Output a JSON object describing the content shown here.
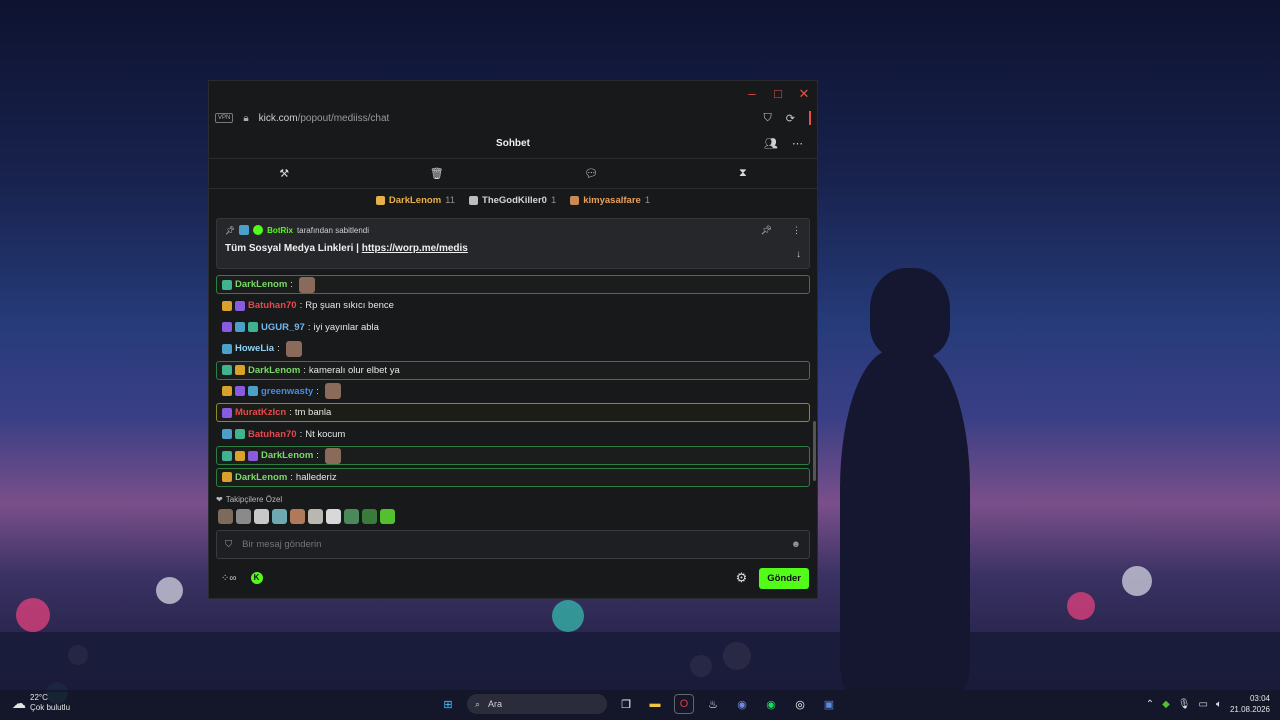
{
  "window": {
    "url_host": "kick.com",
    "url_path": "/popout/mediiss/chat",
    "vpn_label": "VPN"
  },
  "chat": {
    "title": "Sohbet",
    "leaders": [
      {
        "name": "DarkLenom",
        "count": "11",
        "color": "#e9b04a"
      },
      {
        "name": "TheGodKiller0",
        "count": "1",
        "color": "#d5d5d5"
      },
      {
        "name": "kimyasalfare",
        "count": "1",
        "color": "#e9a05a"
      }
    ],
    "pinned": {
      "by_user": "BotRix",
      "by_suffix": "tarafından sabitlendi",
      "text": "Tüm Sosyal Medya Linkleri | ",
      "link": "https://worp.me/medis"
    },
    "messages": [
      {
        "user": "DarkLenom",
        "text": "",
        "color": "#7bd96a",
        "highlight": "green",
        "emote": true
      },
      {
        "user": "Batuhan70",
        "text": "Rp şuan sıkıcı bence",
        "color": "#e5484d",
        "highlight": "",
        "emote": false
      },
      {
        "user": "UGUR_97",
        "text": "iyi yayınlar abla",
        "color": "#6fb8f0",
        "highlight": "",
        "emote": false
      },
      {
        "user": "HoweLia",
        "text": "",
        "color": "#8fd3f0",
        "highlight": "",
        "emote": true
      },
      {
        "user": "DarkLenom",
        "text": "kameralı olur elbet ya",
        "color": "#7bd96a",
        "highlight": "green",
        "emote": false
      },
      {
        "user": "greenwasty",
        "text": "",
        "color": "#4a8ae0",
        "highlight": "",
        "emote": true
      },
      {
        "user": "MuratKzIcn",
        "text": "tm banla",
        "color": "#e5484d",
        "highlight": "yellow",
        "emote": false
      },
      {
        "user": "Batuhan70",
        "text": "Nt kocum",
        "color": "#e5484d",
        "highlight": "",
        "emote": false
      },
      {
        "user": "DarkLenom",
        "text": "",
        "color": "#7bd96a",
        "highlight": "green",
        "emote": true
      },
      {
        "user": "DarkLenom",
        "text": "hallederiz",
        "color": "#7bd96a",
        "highlight": "green",
        "emote": false
      }
    ],
    "followers_label": "Takipçilere Özel",
    "input_placeholder": "Bir mesaj gönderin",
    "send_label": "Gönder"
  },
  "taskbar": {
    "temperature": "22°C",
    "weather": "Çok bulutlu",
    "search_placeholder": "Ara",
    "time": "03:04",
    "date": "21.08.2026"
  }
}
